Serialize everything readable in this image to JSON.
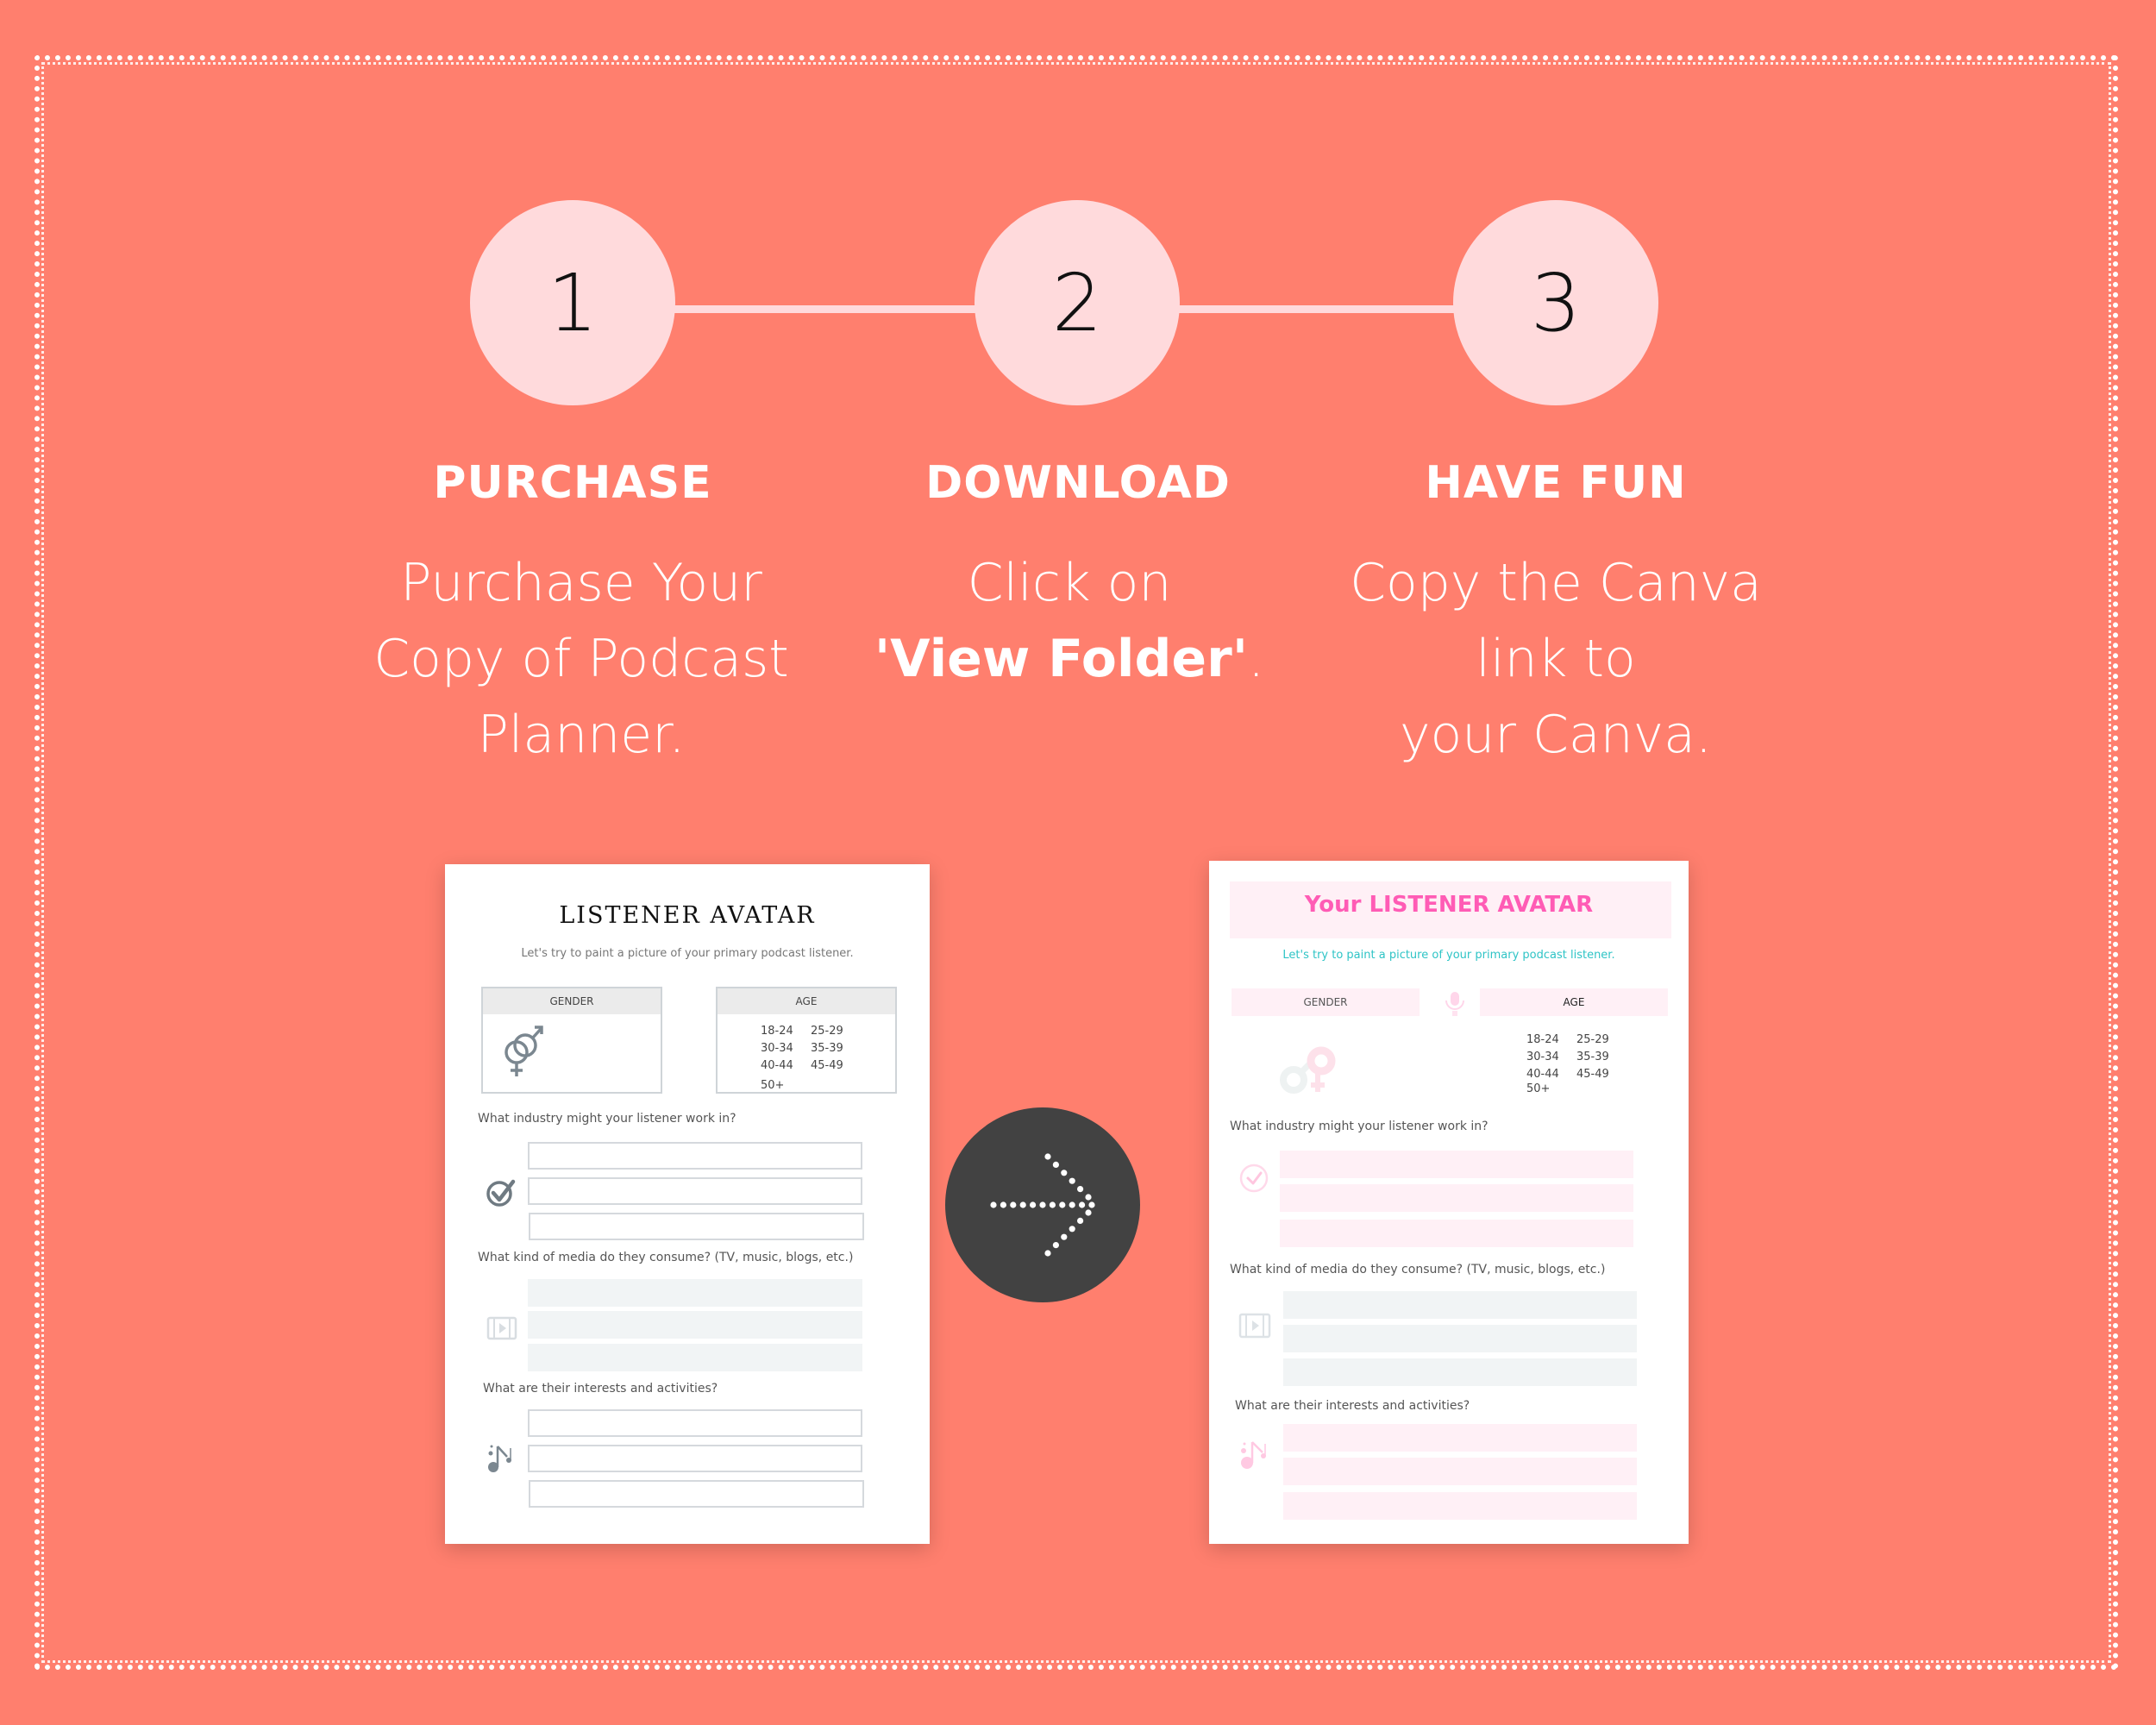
{
  "theme": {
    "background": "#FF7F6E",
    "step_circle": "#FFDADC",
    "arrow_circle": "#424242",
    "pink_accent": "#FF5CB5",
    "teal_accent": "#2EC4C6"
  },
  "steps": [
    {
      "number": "1",
      "title": "PURCHASE",
      "description_lines": [
        "Purchase Your",
        "Copy of Podcast",
        "Planner."
      ]
    },
    {
      "number": "2",
      "title": "DOWNLOAD",
      "description_line1": "Click  on",
      "description_bold": "'View Folder'",
      "description_suffix": "."
    },
    {
      "number": "3",
      "title": "HAVE FUN",
      "description_lines": [
        "Copy the Canva",
        "link to",
        "your Canva."
      ]
    }
  ],
  "arrow": {
    "icon": "dotted-arrow-right-icon"
  },
  "before_doc": {
    "title": "LISTENER AVATAR",
    "subtitle": "Let's try to paint a picture of your primary podcast listener.",
    "gender_label": "GENDER",
    "age_label": "AGE",
    "age_ranges": [
      "18-24",
      "25-29",
      "30-34",
      "35-39",
      "40-44",
      "45-49",
      "50+"
    ],
    "questions": [
      {
        "text": "What industry might your listener work in?",
        "icon": "checkmark-circle-icon",
        "style": "outline"
      },
      {
        "text": "What kind of media do they consume? (TV, music, blogs, etc.)",
        "icon": "film-icon",
        "style": "grey"
      },
      {
        "text": "What are their interests and activities?",
        "icon": "music-note-icon",
        "style": "outline"
      }
    ]
  },
  "after_doc": {
    "title": "Your LISTENER AVATAR",
    "subtitle": "Let's try to paint a picture of your primary podcast listener.",
    "gender_label": "GENDER",
    "age_label": "AGE",
    "age_ranges": [
      "18-24",
      "25-29",
      "30-34",
      "35-39",
      "40-44",
      "45-49",
      "50+"
    ],
    "questions": [
      {
        "text": "What industry might your listener work in?",
        "icon": "checkmark-circle-icon",
        "style": "pink"
      },
      {
        "text": "What kind of media do they consume? (TV, music, blogs, etc.)",
        "icon": "film-icon",
        "style": "grey"
      },
      {
        "text": "What are their interests and activities?",
        "icon": "music-note-icon",
        "style": "pink"
      }
    ]
  }
}
